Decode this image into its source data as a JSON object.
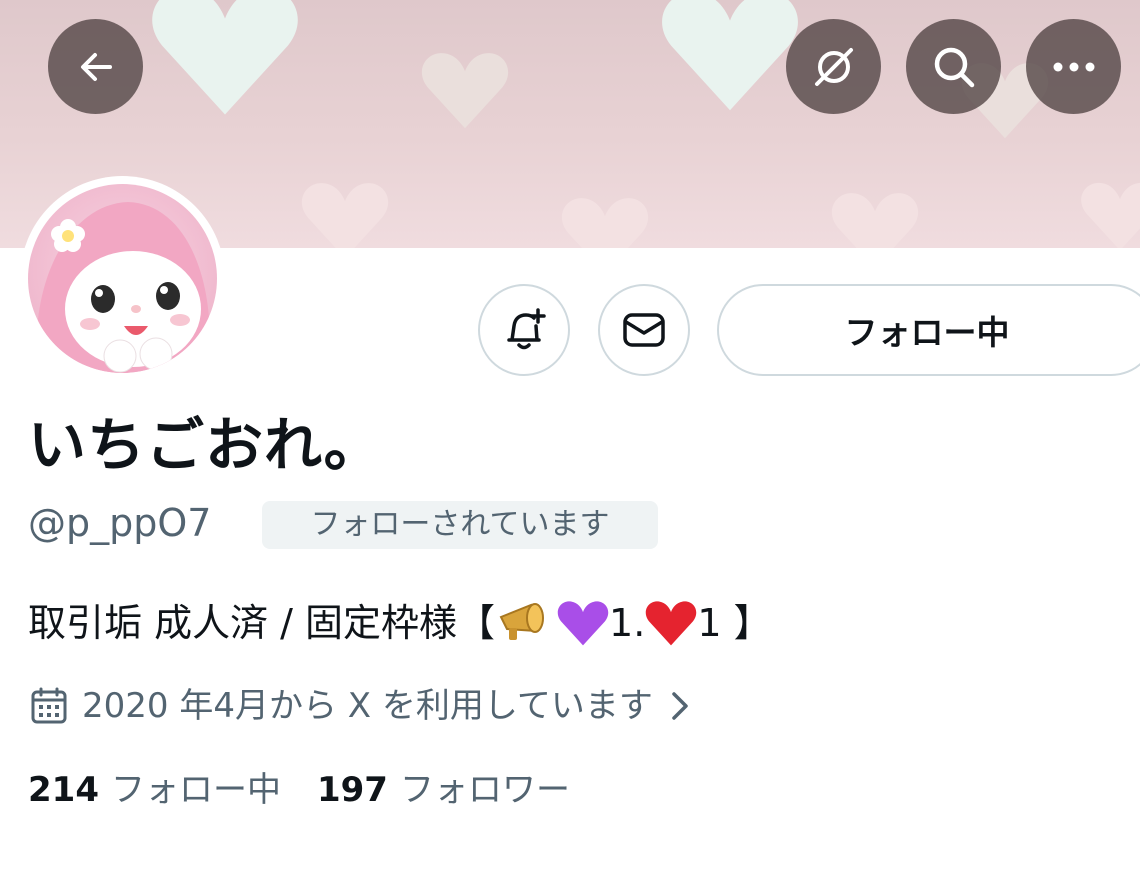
{
  "header": {
    "back_icon": "arrow-left-icon",
    "grok_icon": "grok-icon",
    "search_icon": "search-icon",
    "more_icon": "more-icon"
  },
  "actions": {
    "notify_icon": "bell-plus-icon",
    "message_icon": "envelope-icon",
    "follow_label": "フォロー中"
  },
  "profile": {
    "display_name": "いちごおれ。",
    "handle": "@p_ppO7",
    "follows_you": "フォローされています",
    "bio_prefix": "取引垢 成人済 / 固定枠様【",
    "bio_mid": "1.",
    "bio_end": "1 】",
    "joined": "2020 年4月から X を利用しています"
  },
  "stats": {
    "following_count": "214",
    "following_label": "フォロー中",
    "followers_count": "197",
    "followers_label": "フォロワー"
  },
  "colors": {
    "text": "#0f1419",
    "secondary": "#536471",
    "border": "#cfd9de"
  }
}
